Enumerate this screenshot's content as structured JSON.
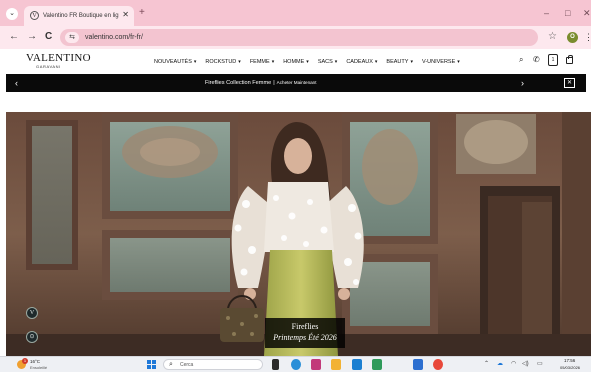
{
  "browser": {
    "tab": {
      "title": "Valentino FR Boutique en ligne",
      "favicon_letter": "V",
      "close_glyph": "✕"
    },
    "tab_menu_glyph": "⌄",
    "new_tab_glyph": "+",
    "window_controls": {
      "minimize": "–",
      "restore": "□",
      "close": "✕"
    },
    "nav": {
      "back": "←",
      "forward": "→",
      "reload": "C"
    },
    "site_info_glyph": "⇆",
    "url": "valentino.com/fr-fr/",
    "bookmark_star": "☆",
    "profile_initial": "O",
    "menu_glyph": "⋮"
  },
  "site": {
    "logo": "VALENTINO",
    "logo_sub": "GARAVANI",
    "nav": [
      {
        "label": "NOUVEAUTÉS",
        "caret": "▾"
      },
      {
        "label": "ROCKSTUD",
        "caret": "▾"
      },
      {
        "label": "FEMME",
        "caret": "▾"
      },
      {
        "label": "HOMME",
        "caret": "▾"
      },
      {
        "label": "SACS",
        "caret": "▾"
      },
      {
        "label": "CADEAUX",
        "caret": "▾"
      },
      {
        "label": "BEAUTY",
        "caret": "▾"
      },
      {
        "label": "V-UNIVERSE",
        "caret": "▾"
      }
    ],
    "icons": {
      "search": "⌕",
      "phone": "✆",
      "account": "1"
    }
  },
  "promo": {
    "prev": "‹",
    "next": "›",
    "text": "Fireflies Collection Femme",
    "separator": "|",
    "cta": "Acheter Maintenant",
    "close": "✕"
  },
  "hero": {
    "caption_title": "Fireflies",
    "caption_subtitle": "Printemps Été 2026",
    "fab_top": "V",
    "fab_bottom": "⊙"
  },
  "taskbar": {
    "weather_temp": "16°C",
    "weather_desc": "Ensoleillé",
    "weather_badge": "1",
    "search_glyph": "⌕",
    "search_placeholder": "Cerca",
    "tray": {
      "chevron": "⌃",
      "wifi": "◠",
      "volume": "◁)",
      "battery": "▭"
    },
    "time": "17:56",
    "date": "05/03/2026"
  },
  "colors": {
    "tab_strip": "#f6c5d2",
    "address_bar": "#fde8ee",
    "omnibox": "#f3c4d0",
    "promo_bg": "#0a0a0a",
    "taskbar": "#eef0f4",
    "start_blue": "#1e78d8"
  }
}
